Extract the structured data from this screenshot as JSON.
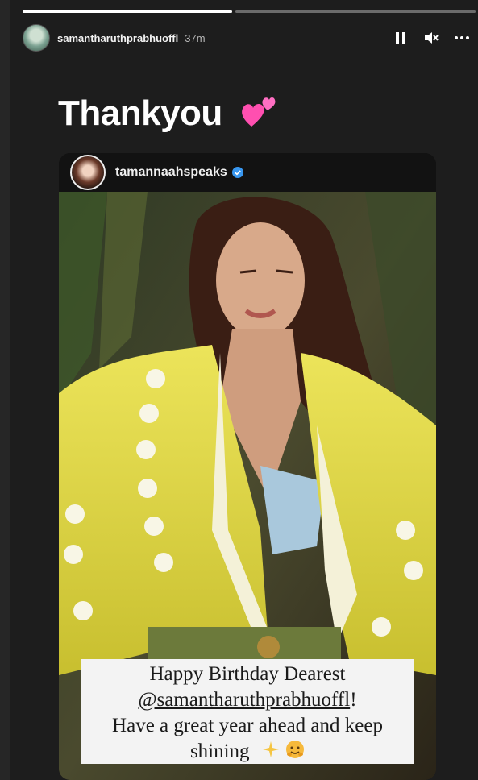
{
  "story": {
    "progress": [
      1,
      0
    ],
    "username": "samantharuthprabhuoffl",
    "time": "37m",
    "caption": "Thankyou"
  },
  "icons": {
    "pause": "pause-icon",
    "mute": "speaker-muted-icon",
    "more": "more-horizontal-icon",
    "heart": "two-hearts-icon",
    "verified": "verified-badge-icon",
    "sparkles": "sparkles-icon",
    "hug": "hugging-face-icon"
  },
  "reshared_post": {
    "username": "tamannaahspeaks",
    "message": {
      "line1": "Happy Birthday Dearest",
      "mention": "@samantharuthprabhuoffl",
      "mention_suffix": "!",
      "line3": "Have a great year ahead and keep",
      "line4": "shining"
    }
  },
  "colors": {
    "background": "#1d1d1d",
    "verified": "#3897f0",
    "heart": "#ff4fb0",
    "shirt": "#e8df4a"
  }
}
